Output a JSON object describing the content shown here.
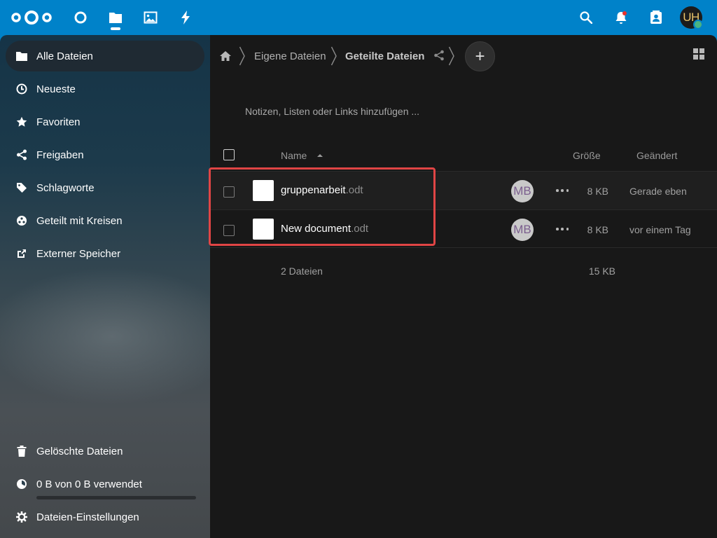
{
  "header": {
    "logo_icon": "nextcloud-logo",
    "apps": [
      {
        "name": "dashboard",
        "icon": "circle-icon"
      },
      {
        "name": "files",
        "icon": "folder-icon",
        "active": true
      },
      {
        "name": "photos",
        "icon": "image-icon"
      },
      {
        "name": "activity",
        "icon": "bolt-icon"
      }
    ],
    "right_icons": [
      "search-icon",
      "bell-icon",
      "contacts-icon"
    ],
    "user_initials": "UH",
    "colors": {
      "header_bg": "#0082c9",
      "notification_dot": "#e9322d",
      "status_online": "#49b382"
    }
  },
  "sidebar": {
    "items": [
      {
        "label": "Alle Dateien",
        "icon": "folder-icon",
        "active": true
      },
      {
        "label": "Neueste",
        "icon": "clock-icon"
      },
      {
        "label": "Favoriten",
        "icon": "star-icon"
      },
      {
        "label": "Freigaben",
        "icon": "share-icon"
      },
      {
        "label": "Schlagworte",
        "icon": "tag-icon"
      },
      {
        "label": "Geteilt mit Kreisen",
        "icon": "circles-icon"
      },
      {
        "label": "Externer Speicher",
        "icon": "external-link-icon"
      }
    ],
    "bottom": {
      "trash": {
        "label": "Gelöschte Dateien",
        "icon": "trash-icon"
      },
      "quota": {
        "label": "0 B von 0 B verwendet",
        "icon": "pie-icon",
        "used_fraction": 0
      },
      "settings": {
        "label": "Dateien-Einstellungen",
        "icon": "gear-icon"
      }
    }
  },
  "breadcrumb": {
    "home_icon": "home-icon",
    "items": [
      "Eigene Dateien",
      "Geteilte Dateien"
    ],
    "share_icon": "share-icon",
    "add_label": "+"
  },
  "notes_placeholder": "Notizen, Listen oder Links hinzufügen ...",
  "table": {
    "columns": {
      "name": "Name",
      "size": "Größe",
      "modified": "Geändert"
    },
    "rows": [
      {
        "basename": "gruppenarbeit",
        "ext": ".odt",
        "owner": "MB",
        "size": "8 KB",
        "modified": "Gerade eben"
      },
      {
        "basename": "New document",
        "ext": ".odt",
        "owner": "MB",
        "size": "8 KB",
        "modified": "vor einem Tag"
      }
    ],
    "summary": {
      "count": "2 Dateien",
      "size": "15 KB"
    }
  },
  "highlight_color": "#e04545"
}
